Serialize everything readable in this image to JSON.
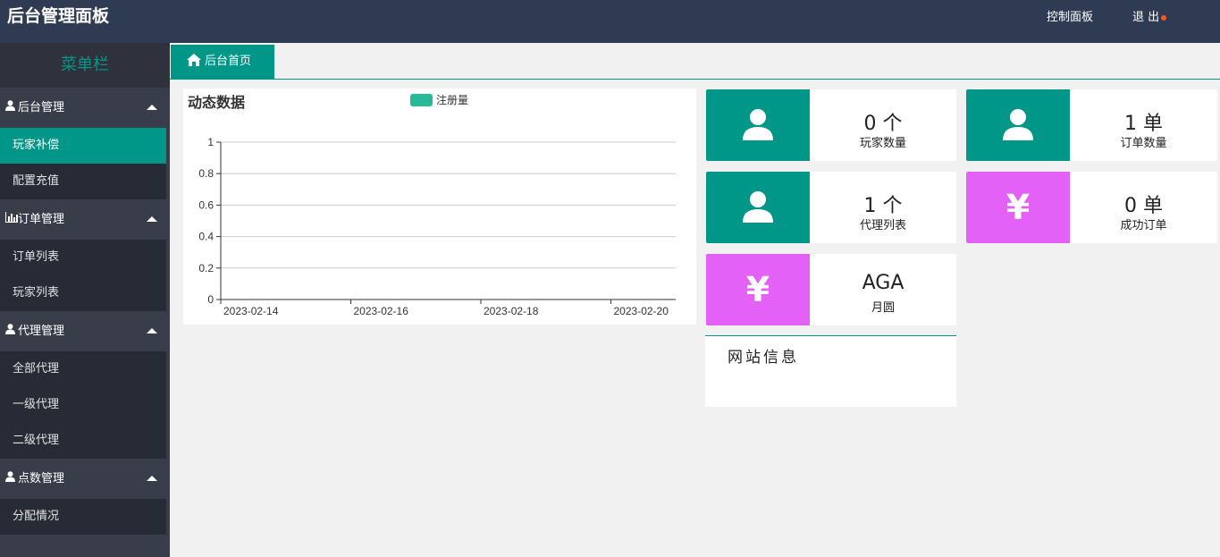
{
  "header": {
    "brand": "后台管理面板",
    "control_panel": "控制面板",
    "logout": "退 出"
  },
  "sidebar": {
    "title": "菜单栏",
    "groups": [
      {
        "label": "后台管理",
        "icon": "user-icon",
        "items": [
          "玩家补偿",
          "配置充值"
        ]
      },
      {
        "label": "订单管理",
        "icon": "bar-chart-icon",
        "items": [
          "订单列表",
          "玩家列表"
        ]
      },
      {
        "label": "代理管理",
        "icon": "user-icon",
        "items": [
          "全部代理",
          "一级代理",
          "二级代理"
        ]
      },
      {
        "label": "点数管理",
        "icon": "user-icon",
        "items": [
          "分配情况"
        ]
      }
    ],
    "active_item": "玩家补偿"
  },
  "tabs": [
    {
      "label": "后台首页",
      "icon": "home-icon"
    }
  ],
  "chart_panel": {
    "title": "动态数据"
  },
  "chart_data": {
    "type": "bar",
    "categories": [
      "2023-02-14",
      "2023-02-16",
      "2023-02-18",
      "2023-02-20"
    ],
    "series": [
      {
        "name": "注册量",
        "values": [
          0,
          0,
          0,
          0
        ]
      }
    ],
    "yticks": [
      "0",
      "0.2",
      "0.4",
      "0.6",
      "0.8",
      "1"
    ],
    "ylim": [
      0,
      1
    ],
    "grid": true,
    "legend_position": "top",
    "color": "#26b99a"
  },
  "stats": {
    "players": {
      "value": "0 个",
      "label": "玩家数量"
    },
    "orders": {
      "value": "1 单",
      "label": "订单数量"
    },
    "agents": {
      "value": "1 个",
      "label": "代理列表"
    },
    "success_orders": {
      "value": "0 单",
      "label": "成功订单"
    },
    "monthly": {
      "value": "AGA",
      "label": "月圆"
    }
  },
  "yen_symbol": "¥",
  "site_info": {
    "title": "网站信息"
  },
  "colors": {
    "teal": "#009688",
    "pink": "#e361f7",
    "topbar": "#2f3b52",
    "sidebar": "#393d49"
  }
}
